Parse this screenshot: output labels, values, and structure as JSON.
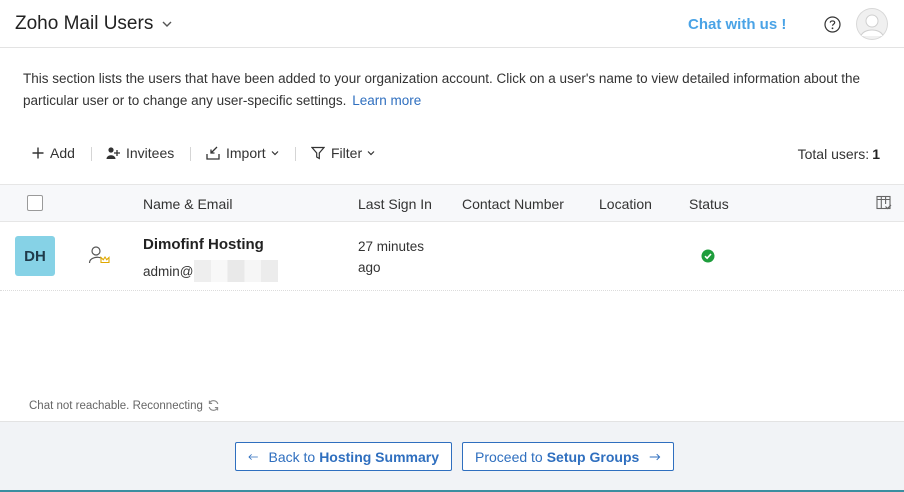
{
  "header": {
    "title": "Zoho Mail Users",
    "chat_link": "Chat with us !",
    "help_icon": "question-circle-icon",
    "profile_icon": "user-avatar-icon"
  },
  "description": {
    "text": "This section lists the users that have been added to your organization account. Click on a user's name to view detailed information about the particular user or to change any user-specific settings.",
    "link": "Learn more"
  },
  "toolbar": {
    "add": "Add",
    "invitees": "Invitees",
    "import": "Import",
    "filter": "Filter",
    "total_label": "Total users:",
    "total_count": "1"
  },
  "table": {
    "columns": [
      "Name & Email",
      "Last Sign In",
      "Contact Number",
      "Location",
      "Status"
    ],
    "rows": [
      {
        "initials": "DH",
        "name": "Dimofinf Hosting",
        "email_prefix": "admin@",
        "last_sign_in": "27 minutes ago",
        "contact_number": "",
        "location": "",
        "status": "active",
        "role_icon": "admin-crown-icon"
      }
    ]
  },
  "chat_status": "Chat not reachable. Reconnecting",
  "footer": {
    "back_prefix": "Back to",
    "back_target": "Hosting Summary",
    "next_prefix": "Proceed to",
    "next_target": "Setup Groups"
  },
  "colors": {
    "accent": "#2f6fbf",
    "chat_link": "#4aa3e6",
    "avatar_bg": "#86d2e6",
    "status_ok": "#1e9d3c",
    "footer_bg": "#f1f3f6"
  }
}
